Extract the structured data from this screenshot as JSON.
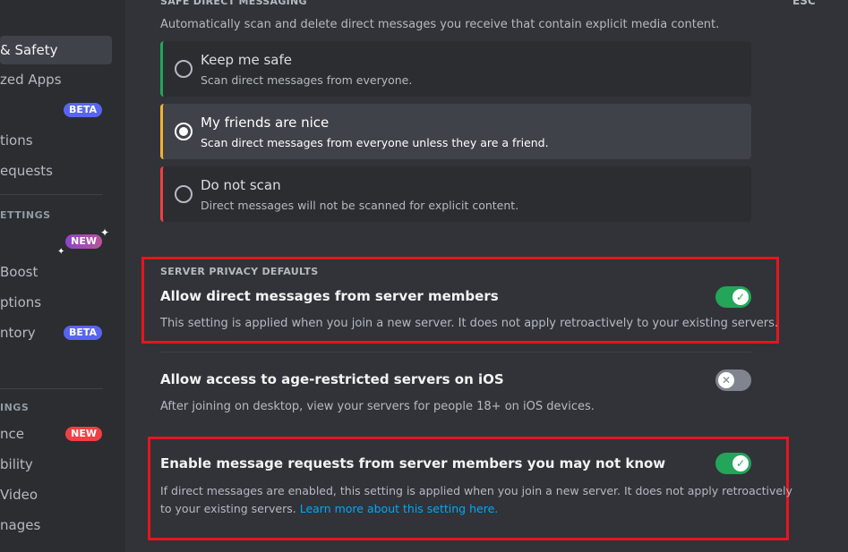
{
  "sidebar": {
    "items": [
      {
        "label": "& Safety",
        "selected": true
      },
      {
        "label": "zed Apps"
      },
      {
        "label": "",
        "badge": "BETA"
      },
      {
        "label": "tions"
      },
      {
        "label": "equests"
      },
      {
        "label": "",
        "badge": "NEW"
      },
      {
        "label": "Boost"
      },
      {
        "label": "ptions"
      },
      {
        "label": "ntory",
        "badge": "BETA"
      },
      {
        "label": "nce",
        "badge": "NEW"
      },
      {
        "label": "bility"
      },
      {
        "label": "Video"
      },
      {
        "label": "nages"
      }
    ],
    "headers": [
      "ETTINGS",
      "INGS"
    ],
    "badge_colors": {
      "beta": "#5865f2",
      "new_gradient": "#9b4dca",
      "new_red": "#f23f43"
    }
  },
  "main": {
    "esc_label": "ESC",
    "safe_dm": {
      "header": "SAFE DIRECT MESSAGING",
      "description": "Automatically scan and delete direct messages you receive that contain explicit media content.",
      "options": [
        {
          "title": "Keep me safe",
          "subtitle": "Scan direct messages from everyone.",
          "color": "#23a55a",
          "selected": false
        },
        {
          "title": "My friends are nice",
          "subtitle": "Scan direct messages from everyone unless they are a friend.",
          "color": "#f0b232",
          "selected": true
        },
        {
          "title": "Do not scan",
          "subtitle": "Direct messages will not be scanned for explicit content.",
          "color": "#f23f43",
          "selected": false
        }
      ]
    },
    "server_privacy": {
      "header": "SERVER PRIVACY DEFAULTS",
      "settings": [
        {
          "title": "Allow direct messages from server members",
          "description": "This setting is applied when you join a new server. It does not apply retroactively to your existing servers.",
          "enabled": true
        },
        {
          "title": "Allow access to age-restricted servers on iOS",
          "description": "After joining on desktop, view your servers for people 18+ on iOS devices.",
          "enabled": false
        },
        {
          "title": "Enable message requests from server members you may not know",
          "description": "If direct messages are enabled, this setting is applied when you join a new server. It does not apply retroactively",
          "description2": "to your existing servers.",
          "link": "Learn more about this setting here.",
          "enabled": true
        }
      ]
    },
    "toggle_icons": {
      "on": "check-icon",
      "off": "x-icon"
    }
  }
}
